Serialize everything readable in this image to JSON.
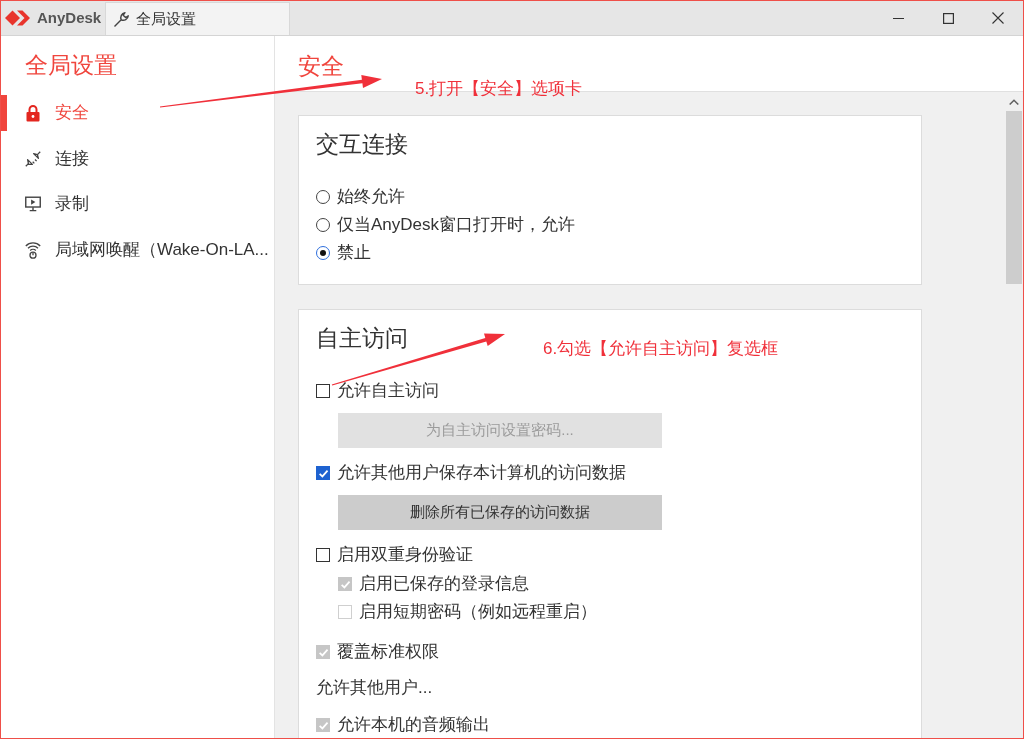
{
  "title_bar": {
    "app_name": "AnyDesk",
    "tab": {
      "label": "全局设置",
      "selected": true
    }
  },
  "sidebar": {
    "title": "全局设置",
    "items": [
      {
        "label": "安全",
        "selected": true
      },
      {
        "label": "连接",
        "selected": false
      },
      {
        "label": "录制",
        "selected": false
      },
      {
        "label": "局域网唤醒（Wake-On-LA...",
        "selected": false
      }
    ]
  },
  "page": {
    "title": "安全",
    "sections": [
      {
        "title": "交互连接",
        "controls": [
          {
            "kind": "radio",
            "label": "始终允许",
            "selected": false
          },
          {
            "kind": "radio",
            "label": "仅当AnyDesk窗口打开时，允许",
            "selected": false
          },
          {
            "kind": "radio",
            "label": "禁止",
            "selected": true
          }
        ]
      },
      {
        "title": "自主访问",
        "controls": [
          {
            "kind": "checkbox",
            "label": "允许自主访问",
            "checked": false,
            "disabled": false
          },
          {
            "kind": "button",
            "label": "为自主访问设置密码...",
            "disabled": true
          },
          {
            "kind": "checkbox",
            "label": "允许其他用户保存本计算机的访问数据",
            "checked": true,
            "disabled": false
          },
          {
            "kind": "button",
            "label": "删除所有已保存的访问数据",
            "disabled": false
          },
          {
            "kind": "checkbox",
            "label": "启用双重身份验证",
            "checked": false,
            "disabled": false,
            "children": [
              {
                "kind": "checkbox",
                "label": "启用已保存的登录信息",
                "checked": true,
                "disabled": true
              },
              {
                "kind": "checkbox",
                "label": "启用短期密码（例如远程重启）",
                "checked": false,
                "disabled": true
              }
            ]
          },
          {
            "kind": "checkbox",
            "label": "覆盖标准权限",
            "checked": true,
            "disabled": true
          },
          {
            "kind": "text",
            "label": "允许其他用户..."
          },
          {
            "kind": "checkbox",
            "label": "允许本机的音频输出",
            "checked": true,
            "disabled": true
          }
        ]
      }
    ]
  },
  "annotations": [
    {
      "text": "5.打开【安全】选项卡"
    },
    {
      "text": "6.勾选【允许自主访问】复选框"
    }
  ]
}
